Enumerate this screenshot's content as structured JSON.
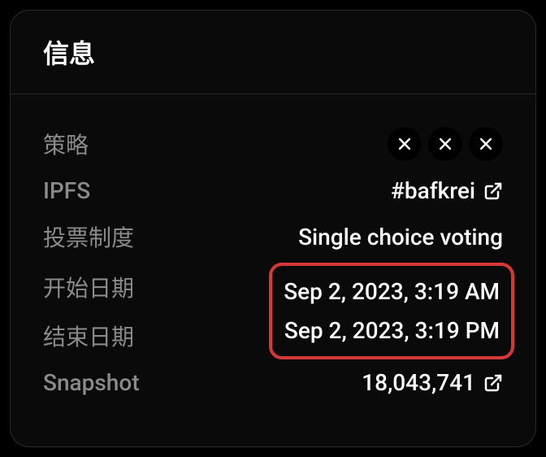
{
  "header": {
    "title": "信息"
  },
  "info": {
    "strategy": {
      "label": "策略"
    },
    "ipfs": {
      "label": "IPFS",
      "value": "#bafkrei"
    },
    "voting_system": {
      "label": "投票制度",
      "value": "Single choice voting"
    },
    "start_date": {
      "label": "开始日期",
      "value": "Sep 2, 2023, 3:19 AM"
    },
    "end_date": {
      "label": "结束日期",
      "value": "Sep 2, 2023, 3:19 PM"
    },
    "snapshot": {
      "label": "Snapshot",
      "value": "18,043,741"
    }
  }
}
